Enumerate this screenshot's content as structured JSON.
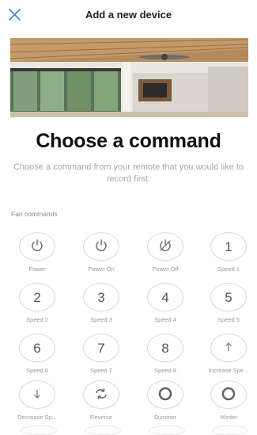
{
  "header": {
    "title": "Add a new device"
  },
  "main": {
    "title": "Choose a command",
    "subtitle": "Choose a command from your remote that you would like to record first."
  },
  "section": {
    "label": "Fan commands"
  },
  "commands": [
    {
      "label": "Power",
      "icon": "power-icon"
    },
    {
      "label": "Power On",
      "icon": "power-icon"
    },
    {
      "label": "Power Off",
      "icon": "power-off-icon"
    },
    {
      "label": "Speed 1",
      "glyph": "1"
    },
    {
      "label": "Speed 2",
      "glyph": "2"
    },
    {
      "label": "Speed 3",
      "glyph": "3"
    },
    {
      "label": "Speed 4",
      "glyph": "4"
    },
    {
      "label": "Speed 5",
      "glyph": "5"
    },
    {
      "label": "Speed 6",
      "glyph": "6"
    },
    {
      "label": "Speed 7",
      "glyph": "7"
    },
    {
      "label": "Speed 8",
      "glyph": "8"
    },
    {
      "label": "Increase Spe...",
      "icon": "arrow-up-icon"
    },
    {
      "label": "Decrease Sp...",
      "icon": "arrow-down-icon"
    },
    {
      "label": "Reverse",
      "icon": "reverse-icon"
    },
    {
      "label": "Summer",
      "icon": "ring-icon"
    },
    {
      "label": "Winter",
      "icon": "ring-icon"
    }
  ],
  "colors": {
    "accent": "#3a8fd6",
    "label": "#9a9a9a",
    "border": "#dadada"
  }
}
